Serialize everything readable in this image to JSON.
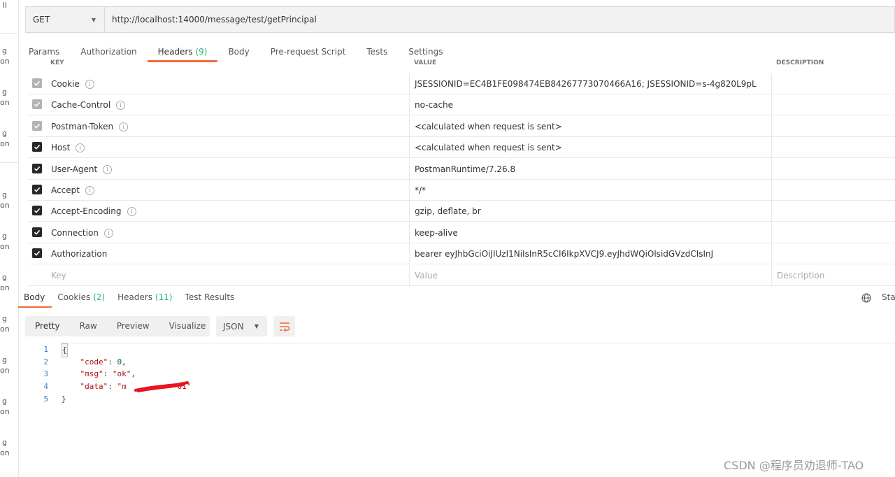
{
  "request": {
    "method": "GET",
    "url": "http://localhost:14000/message/test/getPrincipal"
  },
  "request_tabs": [
    {
      "label": "Params",
      "count": ""
    },
    {
      "label": "Authorization",
      "count": ""
    },
    {
      "label": "Headers",
      "count": "(9)"
    },
    {
      "label": "Body",
      "count": ""
    },
    {
      "label": "Pre-request Script",
      "count": ""
    },
    {
      "label": "Tests",
      "count": ""
    },
    {
      "label": "Settings",
      "count": ""
    }
  ],
  "headers_table": {
    "columns": [
      "KEY",
      "VALUE",
      "DESCRIPTION"
    ],
    "rows": [
      {
        "key": "Cookie",
        "value": "JSESSIONID=EC4B1FE098474EB84267773070466A16; JSESSIONID=s-4g820L9pL",
        "checked": true,
        "style": "grey",
        "info": true
      },
      {
        "key": "Cache-Control",
        "value": "no-cache",
        "checked": true,
        "style": "grey",
        "info": true
      },
      {
        "key": "Postman-Token",
        "value": "<calculated when request is sent>",
        "checked": true,
        "style": "grey",
        "info": true
      },
      {
        "key": "Host",
        "value": "<calculated when request is sent>",
        "checked": true,
        "style": "black",
        "info": true
      },
      {
        "key": "User-Agent",
        "value": "PostmanRuntime/7.26.8",
        "checked": true,
        "style": "black",
        "info": true
      },
      {
        "key": "Accept",
        "value": "*/*",
        "checked": true,
        "style": "black",
        "info": true
      },
      {
        "key": "Accept-Encoding",
        "value": "gzip, deflate, br",
        "checked": true,
        "style": "black",
        "info": true
      },
      {
        "key": "Connection",
        "value": "keep-alive",
        "checked": true,
        "style": "black",
        "info": true
      },
      {
        "key": "Authorization",
        "value": "bearer eyJhbGciOiJIUzI1NiIsInR5cCI6IkpXVCJ9.eyJhdWQiOlsidGVzdCIsInJ",
        "checked": true,
        "style": "black",
        "info": false
      }
    ],
    "placeholder": {
      "key": "Key",
      "value": "Value",
      "description": "Description"
    }
  },
  "response_tabs": [
    {
      "label": "Body",
      "count": ""
    },
    {
      "label": "Cookies",
      "count": "(2)"
    },
    {
      "label": "Headers",
      "count": "(11)"
    },
    {
      "label": "Test Results",
      "count": ""
    }
  ],
  "response_status_partial": "Stat",
  "view_modes": [
    "Pretty",
    "Raw",
    "Preview",
    "Visualize"
  ],
  "format": "JSON",
  "response_body_lines": [
    {
      "n": "1",
      "text": "{"
    },
    {
      "n": "2",
      "text": "    \"code\": 0,"
    },
    {
      "n": "3",
      "text": "    \"msg\": \"ok\","
    },
    {
      "n": "4",
      "text": "    \"data\": \"m           01\""
    },
    {
      "n": "5",
      "text": "}"
    }
  ],
  "sidebar_fragments": [
    "ll",
    "g",
    "on",
    "g",
    "on",
    "g",
    "on",
    "g",
    "on",
    "g",
    "on",
    "g",
    "on",
    "g",
    "on",
    "g",
    "on",
    "g",
    "on",
    "g",
    "on"
  ],
  "watermark": "CSDN @程序员劝退师-TAO",
  "colors": {
    "accent": "#f26b3a",
    "count_green": "#26b47f",
    "redaction": "#e8141e"
  }
}
